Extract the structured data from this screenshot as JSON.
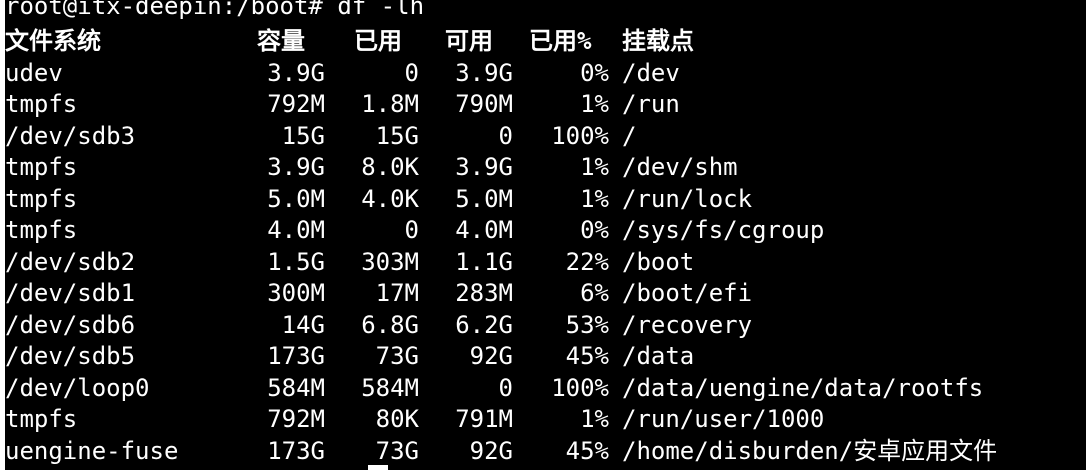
{
  "terminal": {
    "prompt": "root@itx-deepin:/boot# df -lh",
    "header": {
      "filesystem": "文件系统",
      "size": "容量",
      "used": "已用",
      "avail": "可用",
      "use_pct": "已用%",
      "mounted_on": "挂载点"
    },
    "rows": [
      {
        "filesystem": "udev",
        "size": "3.9G",
        "used": "0",
        "avail": "3.9G",
        "use_pct": "0%",
        "mounted_on": "/dev"
      },
      {
        "filesystem": "tmpfs",
        "size": "792M",
        "used": "1.8M",
        "avail": "790M",
        "use_pct": "1%",
        "mounted_on": "/run"
      },
      {
        "filesystem": "/dev/sdb3",
        "size": "15G",
        "used": "15G",
        "avail": "0",
        "use_pct": "100%",
        "mounted_on": "/"
      },
      {
        "filesystem": "tmpfs",
        "size": "3.9G",
        "used": "8.0K",
        "avail": "3.9G",
        "use_pct": "1%",
        "mounted_on": "/dev/shm"
      },
      {
        "filesystem": "tmpfs",
        "size": "5.0M",
        "used": "4.0K",
        "avail": "5.0M",
        "use_pct": "1%",
        "mounted_on": "/run/lock"
      },
      {
        "filesystem": "tmpfs",
        "size": "4.0M",
        "used": "0",
        "avail": "4.0M",
        "use_pct": "0%",
        "mounted_on": "/sys/fs/cgroup"
      },
      {
        "filesystem": "/dev/sdb2",
        "size": "1.5G",
        "used": "303M",
        "avail": "1.1G",
        "use_pct": "22%",
        "mounted_on": "/boot"
      },
      {
        "filesystem": "/dev/sdb1",
        "size": "300M",
        "used": "17M",
        "avail": "283M",
        "use_pct": "6%",
        "mounted_on": "/boot/efi"
      },
      {
        "filesystem": "/dev/sdb6",
        "size": "14G",
        "used": "6.8G",
        "avail": "6.2G",
        "use_pct": "53%",
        "mounted_on": "/recovery"
      },
      {
        "filesystem": "/dev/sdb5",
        "size": "173G",
        "used": "73G",
        "avail": "92G",
        "use_pct": "45%",
        "mounted_on": "/data"
      },
      {
        "filesystem": "/dev/loop0",
        "size": "584M",
        "used": "584M",
        "avail": "0",
        "use_pct": "100%",
        "mounted_on": "/data/uengine/data/rootfs"
      },
      {
        "filesystem": "tmpfs",
        "size": "792M",
        "used": "80K",
        "avail": "791M",
        "use_pct": "1%",
        "mounted_on": "/run/user/1000"
      },
      {
        "filesystem": "uengine-fuse",
        "size": "173G",
        "used": "73G",
        "avail": "92G",
        "use_pct": "45%",
        "mounted_on": "/home/disburden/安卓应用文件"
      }
    ],
    "colors": {
      "background": "#000000",
      "foreground": "#ffffff"
    }
  }
}
